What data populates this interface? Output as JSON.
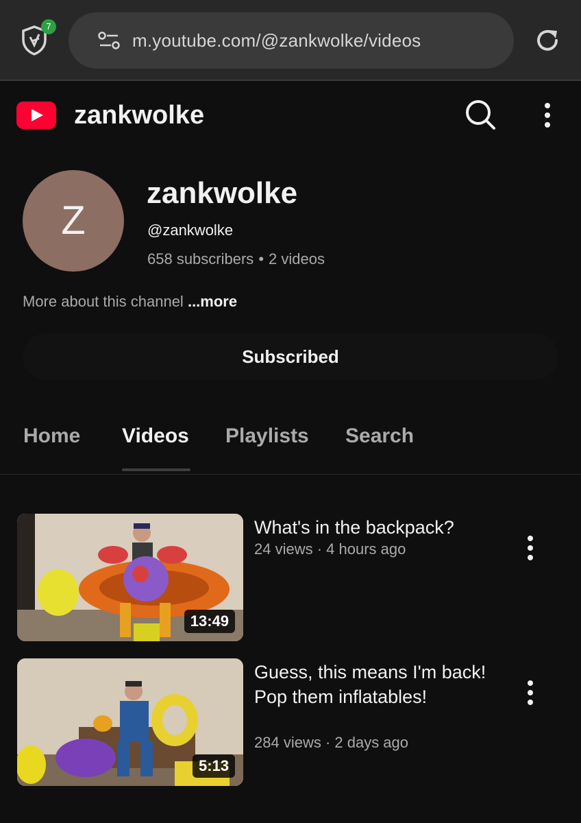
{
  "browser": {
    "url": "m.youtube.com/@zankwolke/videos",
    "shield_badge": "7"
  },
  "header": {
    "title": "zankwolke"
  },
  "channel": {
    "avatar_letter": "Z",
    "name": "zankwolke",
    "handle": "@zankwolke",
    "subscribers": "658 subscribers",
    "separator": "•",
    "videos": "2 videos",
    "about": "More about this channel",
    "more": "...more",
    "subscribed_label": "Subscribed"
  },
  "tabs": [
    {
      "label": "Home",
      "active": false
    },
    {
      "label": "Videos",
      "active": true
    },
    {
      "label": "Playlists",
      "active": false
    },
    {
      "label": "Search",
      "active": false
    }
  ],
  "videos": [
    {
      "title": "What's in the backpack?",
      "meta": "24 views · 4 hours ago",
      "duration": "13:49"
    },
    {
      "title": "Guess, this means I'm back! Pop them inflatables!",
      "meta": "284 views · 2 days ago",
      "duration": "5:13"
    }
  ],
  "colors": {
    "background": "#0f0f0f",
    "youtube_red": "#ff0033",
    "avatar": "#8d6e63"
  }
}
